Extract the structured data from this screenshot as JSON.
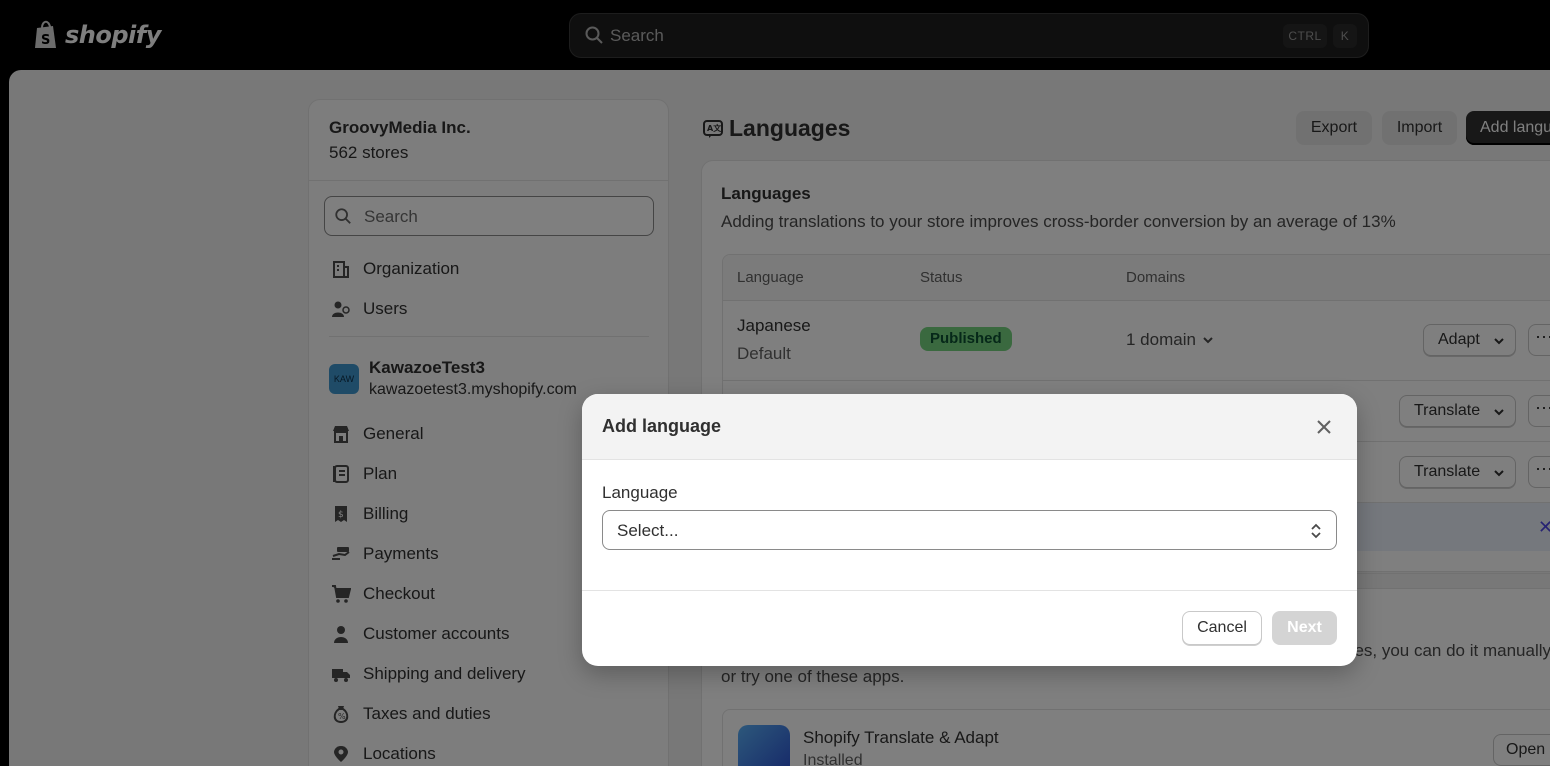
{
  "topbar": {
    "logo_text": "shopify",
    "search_placeholder": "Search",
    "shortcut_ctrl": "CTRL",
    "shortcut_key": "K"
  },
  "sidebar": {
    "org_name": "GroovyMedia Inc.",
    "org_count": "562 stores",
    "search_placeholder": "Search",
    "org_items": [
      {
        "label": "Organization",
        "icon": "building-icon"
      },
      {
        "label": "Users",
        "icon": "users-icon"
      }
    ],
    "store": {
      "avatar": "KAW",
      "name": "KawazoeTest3",
      "domain": "kawazoetest3.myshopify.com"
    },
    "items": [
      {
        "label": "General",
        "icon": "store-icon"
      },
      {
        "label": "Plan",
        "icon": "plan-icon"
      },
      {
        "label": "Billing",
        "icon": "billing-icon"
      },
      {
        "label": "Payments",
        "icon": "payments-icon"
      },
      {
        "label": "Checkout",
        "icon": "cart-icon"
      },
      {
        "label": "Customer accounts",
        "icon": "person-icon"
      },
      {
        "label": "Shipping and delivery",
        "icon": "truck-icon"
      },
      {
        "label": "Taxes and duties",
        "icon": "taxes-icon"
      },
      {
        "label": "Locations",
        "icon": "location-icon"
      }
    ]
  },
  "main": {
    "title": "Languages",
    "export_label": "Export",
    "import_label": "Import",
    "add_label": "Add langu",
    "card": {
      "title": "Languages",
      "description": "Adding translations to your store improves cross-border conversion by an average of 13%",
      "columns": [
        "Language",
        "Status",
        "Domains"
      ],
      "row": {
        "language": "Japanese",
        "sublabel": "Default",
        "status": "Published",
        "domains": "1 domain",
        "action": "Adapt"
      },
      "row2_action": "Translate",
      "row3_action": "Translate"
    },
    "card2": {
      "line1": "es, you can do it manually",
      "line2": "or try one of these apps.",
      "app_name": "Shopify Translate & Adapt",
      "app_status": "Installed",
      "open_label": "Open"
    }
  },
  "modal": {
    "title": "Add language",
    "field_label": "Language",
    "select_value": "Select...",
    "cancel_label": "Cancel",
    "next_label": "Next"
  },
  "colors": {
    "accent_dark": "#303030",
    "badge_green": "#74d37e",
    "disabled": "#d4d4d4"
  }
}
